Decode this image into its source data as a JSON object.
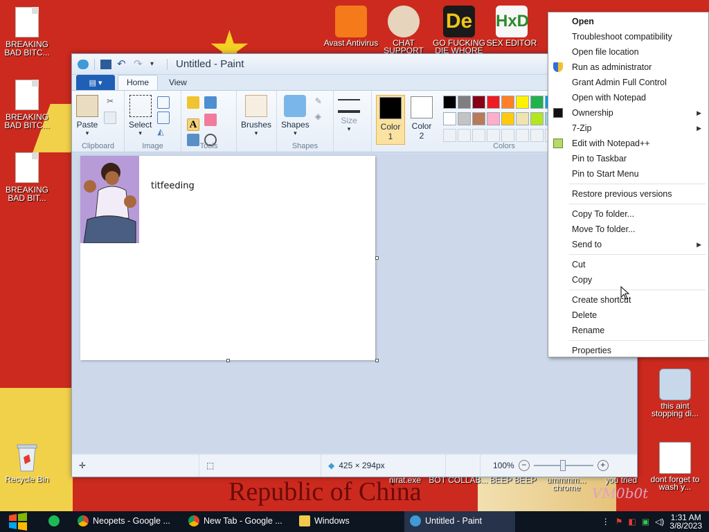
{
  "desktop": {
    "left_icons": [
      {
        "label": "BREAKING BAD BITC..."
      },
      {
        "label": "BREAKING BAD BITC..."
      },
      {
        "label": "BREAKING BAD BIT..."
      }
    ],
    "recycle_bin": "Recycle Bin",
    "top_icons": [
      {
        "label": "Avast Antivirus"
      },
      {
        "label": "CHAT SUPPORT"
      },
      {
        "label": "GO FUCKING DIE WHORE"
      },
      {
        "label": "SEX EDITOR"
      }
    ],
    "right_icons": [
      {
        "label": "this aint stopping di..."
      },
      {
        "label": "dont forget to wash y..."
      }
    ],
    "bottom_icons": [
      {
        "label": "nirat.exe"
      },
      {
        "label": "BOT COLLAB..."
      },
      {
        "label": "BEEP BEEP"
      },
      {
        "label": "ummmm... chrome"
      },
      {
        "label": "you tried"
      }
    ],
    "banner_text": "Republic of China",
    "graffiti": "VM0b0t"
  },
  "paint": {
    "title": "Untitled - Paint",
    "tabs": [
      "Home",
      "View"
    ],
    "groups": {
      "clipboard": {
        "name": "Clipboard",
        "paste": "Paste"
      },
      "image": {
        "name": "Image",
        "select": "Select"
      },
      "tools": {
        "name": "Tools"
      },
      "brushes": "Brushes",
      "shapes": {
        "name": "Shapes",
        "label": "Shapes"
      },
      "size": "Size",
      "color1": "Color 1",
      "color2": "Color 2",
      "colors": "Colors"
    },
    "palette_row1": [
      "#000000",
      "#7f7f7f",
      "#880015",
      "#ed1c24",
      "#ff7f27",
      "#fff200",
      "#22b14c",
      "#00a2e8"
    ],
    "palette_row2": [
      "#ffffff",
      "#c3c3c3",
      "#b97a57",
      "#ffaec9",
      "#ffc90e",
      "#efe4b0",
      "#b5e61d",
      "#99d9ea"
    ],
    "canvas_text": "titfeeding",
    "status": {
      "dimensions": "425 × 294px",
      "zoom": "100%"
    }
  },
  "context_menu": {
    "items": [
      {
        "label": "Open",
        "bold": true
      },
      {
        "label": "Troubleshoot compatibility"
      },
      {
        "label": "Open file location"
      },
      {
        "label": "Run as administrator",
        "icon": "shield-icon"
      },
      {
        "label": "Grant Admin Full Control"
      },
      {
        "label": "Open with Notepad"
      },
      {
        "label": "Ownership",
        "icon": "cmd-icon",
        "submenu": true
      },
      {
        "label": "7-Zip",
        "submenu": true
      },
      {
        "label": "Edit with Notepad++",
        "icon": "notepadpp-icon"
      },
      {
        "label": "Pin to Taskbar"
      },
      {
        "label": "Pin to Start Menu"
      },
      {
        "sep": true
      },
      {
        "label": "Restore previous versions"
      },
      {
        "sep": true
      },
      {
        "label": "Copy To folder..."
      },
      {
        "label": "Move To folder..."
      },
      {
        "label": "Send to",
        "submenu": true
      },
      {
        "sep": true
      },
      {
        "label": "Cut"
      },
      {
        "label": "Copy"
      },
      {
        "sep": true
      },
      {
        "label": "Create shortcut"
      },
      {
        "label": "Delete"
      },
      {
        "label": "Rename"
      },
      {
        "sep": true
      },
      {
        "label": "Properties"
      }
    ]
  },
  "taskbar": {
    "items": [
      {
        "label": "Neopets - Google ...",
        "icon": "chrome-icon"
      },
      {
        "label": "New Tab - Google ...",
        "icon": "chrome-icon"
      },
      {
        "label": "Windows",
        "icon": "folder-icon"
      },
      {
        "label": "Untitled - Paint",
        "icon": "paint-icon",
        "active": true
      }
    ],
    "time": "1:31 AM",
    "date": "3/8/2023"
  }
}
